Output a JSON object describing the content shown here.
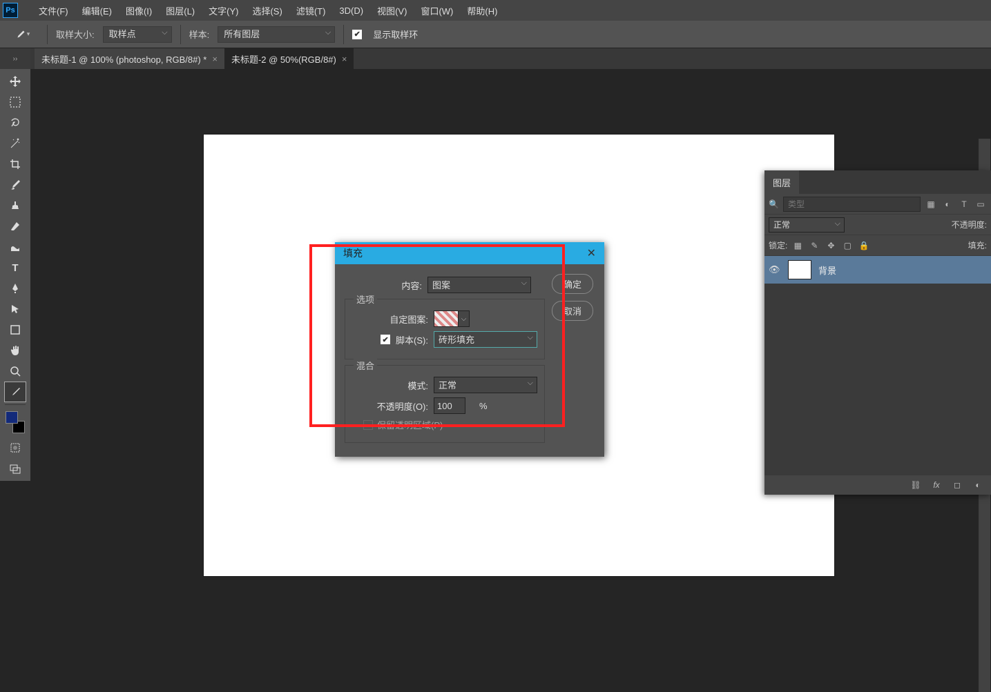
{
  "menu": {
    "items": [
      "文件(F)",
      "编辑(E)",
      "图像(I)",
      "图层(L)",
      "文字(Y)",
      "选择(S)",
      "滤镜(T)",
      "3D(D)",
      "视图(V)",
      "窗口(W)",
      "帮助(H)"
    ]
  },
  "optionsbar": {
    "sample_size_label": "取样大小:",
    "sample_size_value": "取样点",
    "sample_label": "样本:",
    "sample_value": "所有图层",
    "show_ring_label": "显示取样环"
  },
  "tabs": [
    {
      "title": "未标题-1 @ 100% (photoshop, RGB/8#) *",
      "active": false
    },
    {
      "title": "未标题-2 @ 50%(RGB/8#)",
      "active": true
    }
  ],
  "dialog": {
    "title": "填充",
    "ok": "确定",
    "cancel": "取消",
    "content_label": "内容:",
    "content_value": "图案",
    "options_legend": "选项",
    "custom_pattern_label": "自定图案:",
    "script_label": "脚本(S):",
    "script_value": "砖形填充",
    "blend_legend": "混合",
    "mode_label": "模式:",
    "mode_value": "正常",
    "opacity_label": "不透明度(O):",
    "opacity_value": "100",
    "opacity_unit": "%",
    "preserve_label": "保留透明区域(P)"
  },
  "layers_panel": {
    "tab": "图层",
    "filter_placeholder": "类型",
    "blend_mode": "正常",
    "opacity_label": "不透明度:",
    "lock_label": "锁定:",
    "fill_label": "填充:",
    "layer_name": "背景"
  }
}
